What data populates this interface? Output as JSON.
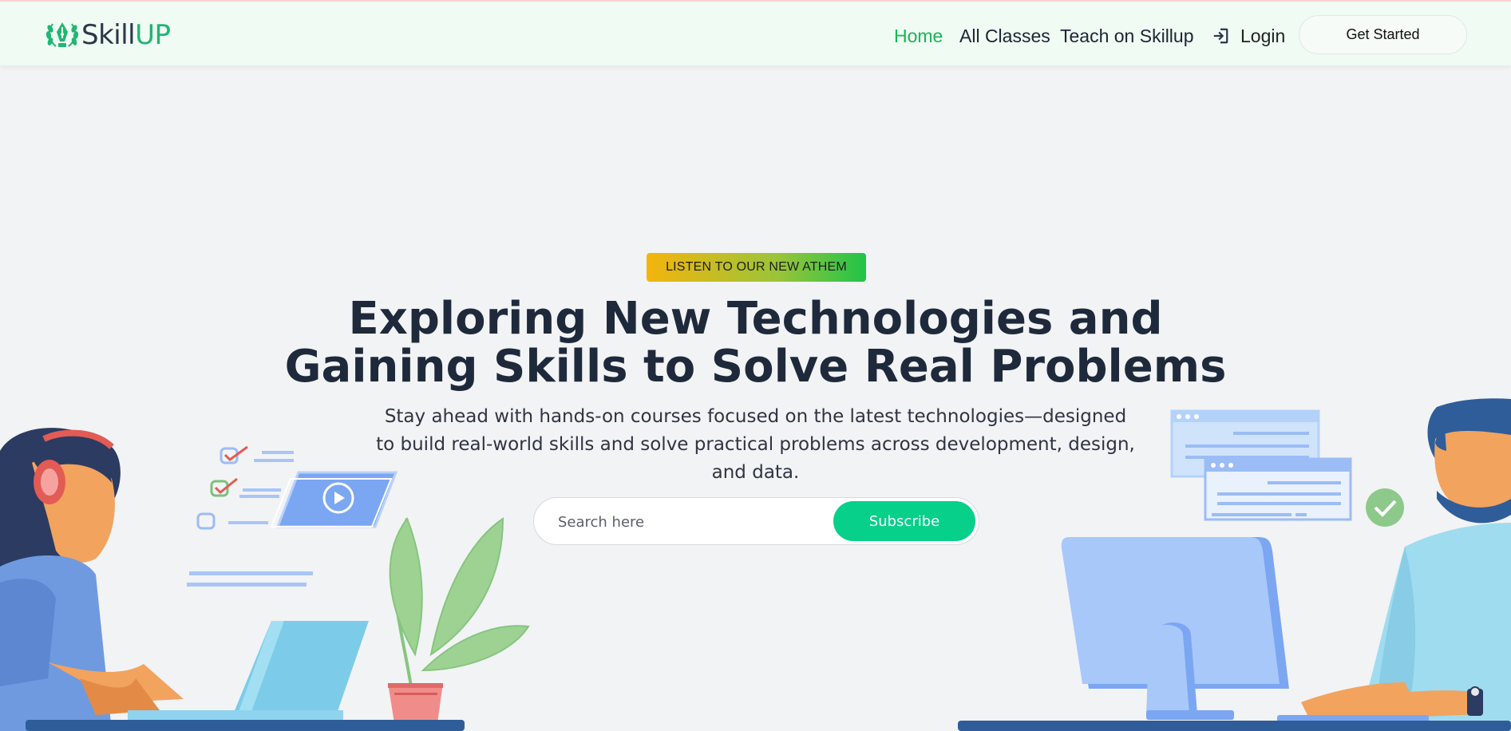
{
  "brand": {
    "name_part1": "Skill",
    "name_part2": "UP"
  },
  "nav": {
    "home": "Home",
    "all_classes": "All Classes",
    "teach": "Teach on Skillup",
    "login": "Login",
    "get_started": "Get Started"
  },
  "hero": {
    "badge": "LISTEN TO OUR NEW ATHEM",
    "headline_line1": "Exploring New Technologies and",
    "headline_line2": "Gaining Skills to Solve Real Problems",
    "subtext": "Stay ahead with hands-on courses focused on the latest technologies—designed to build real-world skills and solve practical problems across development, design, and data.",
    "search_placeholder": "Search here",
    "subscribe": "Subscribe"
  },
  "colors": {
    "brand_green": "#22b573",
    "nav_active": "#19b556",
    "subscribe_bg": "#06d08a",
    "navbar_bg": "#effbf3",
    "page_bg": "#f2f3f5",
    "headline": "#1e2a3b"
  },
  "icons": {
    "logo": "laurel-pen-logo-icon",
    "login": "sign-in-arrow-icon",
    "play": "play-icon",
    "check": "check-icon"
  }
}
